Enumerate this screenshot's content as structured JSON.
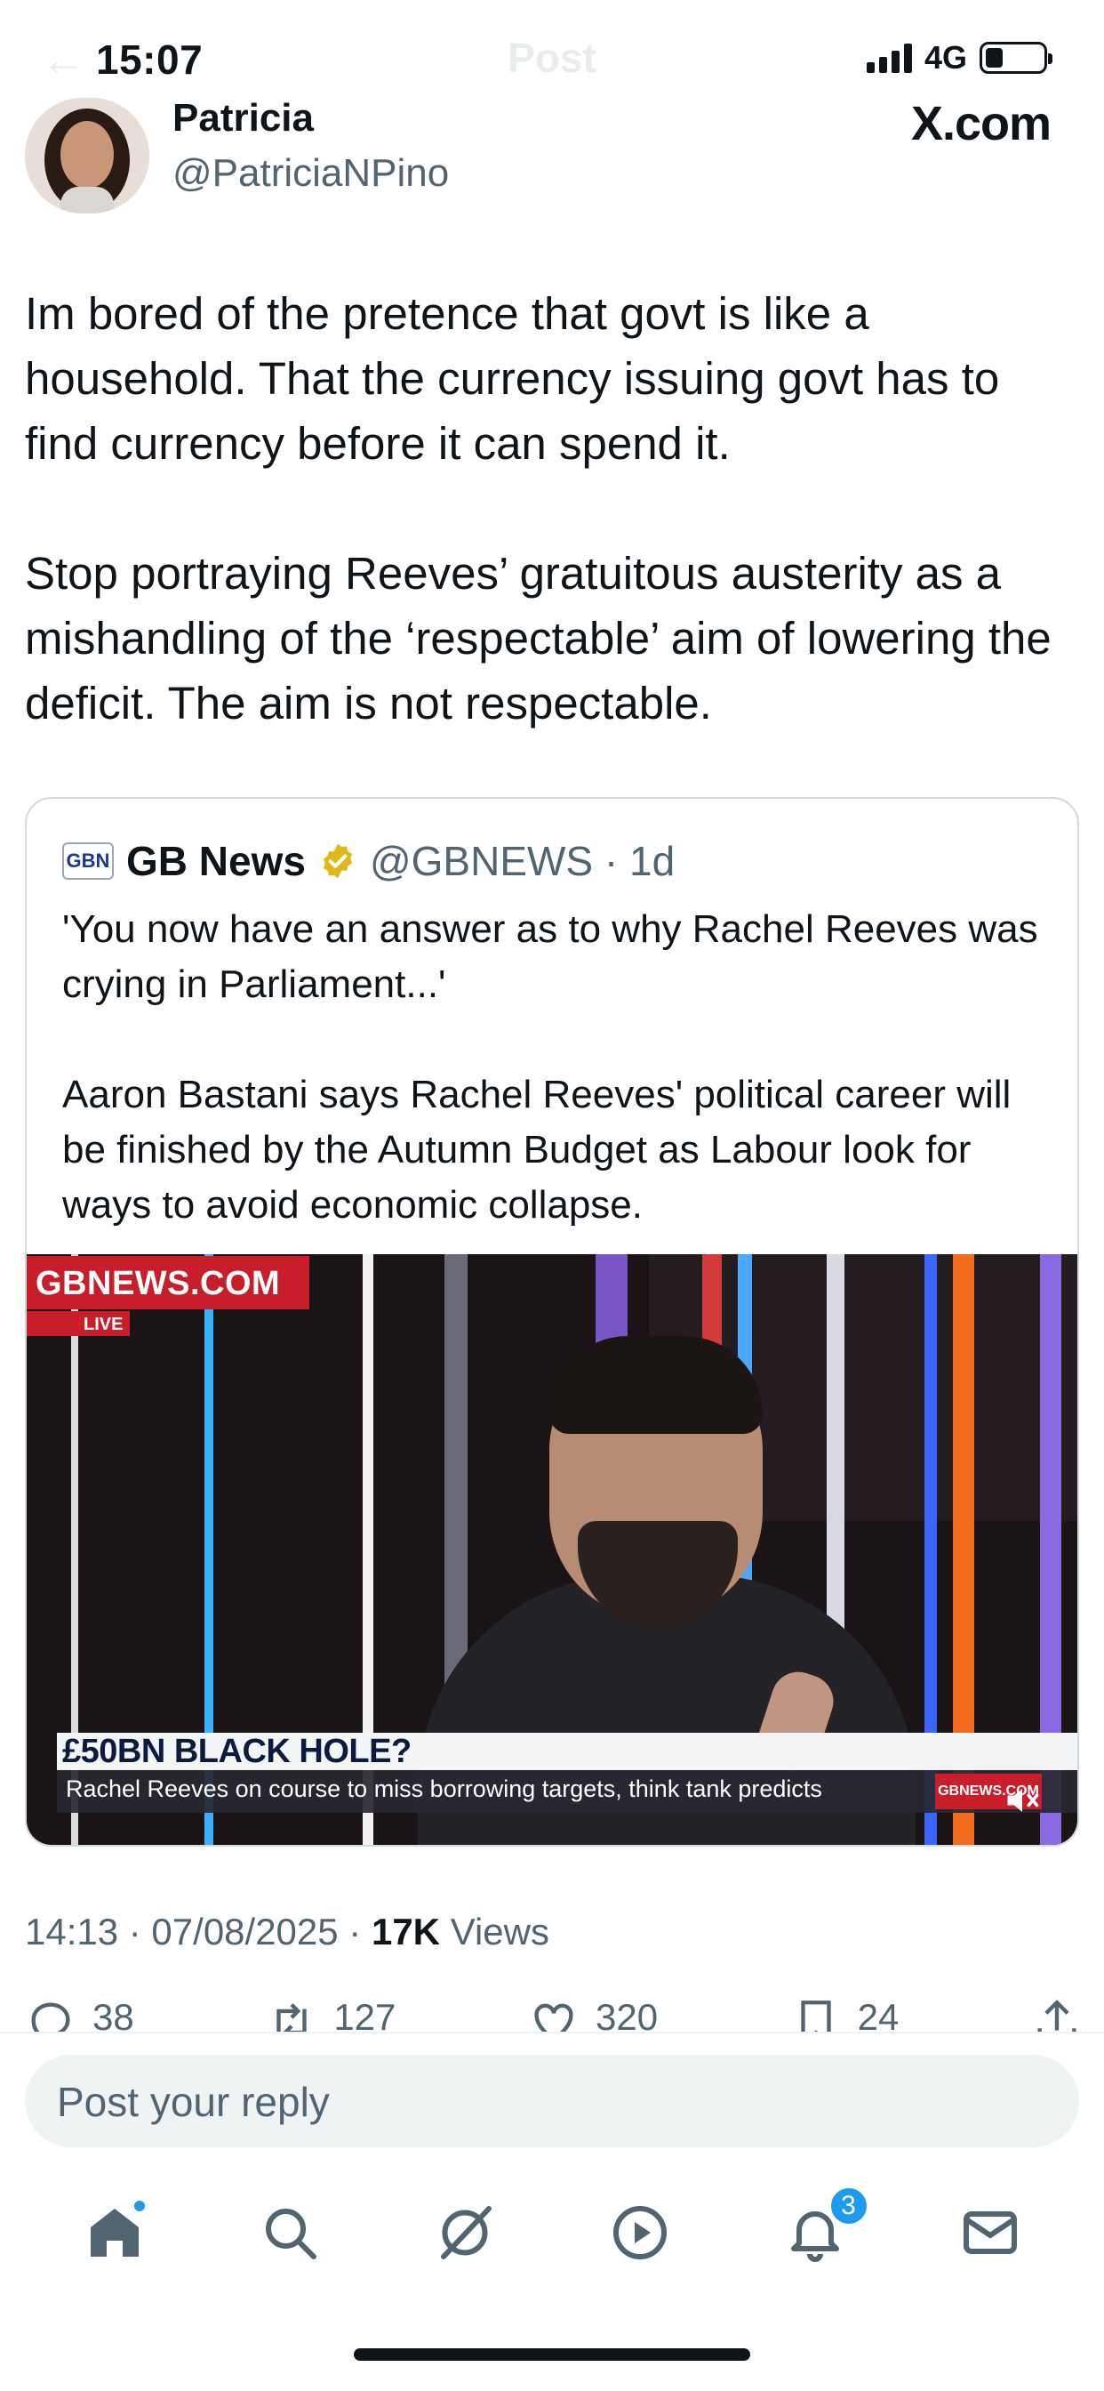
{
  "status_bar": {
    "time": "15:07",
    "network": "4G",
    "battery_level": 0.3
  },
  "header": {
    "title": "Post"
  },
  "author": {
    "name": "Patricia",
    "handle": "@PatriciaNPino",
    "source_badge": "X.com"
  },
  "post": {
    "paragraphs": [
      "Im bored of the pretence that govt is like a household. That the currency issuing govt has to find currency before it can spend it.",
      "Stop portraying Reeves’ gratuitous austerity as a mishandling of the ‘respectable’ aim of lowering the deficit. The aim is not respectable."
    ],
    "timestamp": "14:13 · 07/08/2025 · ",
    "views_count": "17K",
    "views_label": " Views"
  },
  "quote": {
    "logo_text": "GBN",
    "name": "GB News",
    "handle": "@GBNEWS · 1d",
    "paragraphs": [
      "'You now have an answer as to why Rachel Reeves was crying in Parliament...'",
      "Aaron Bastani says Rachel Reeves' political career will be finished by the Autumn Budget as Labour look for ways to avoid economic collapse."
    ],
    "video": {
      "channel_bug": "GBNEWS.COM",
      "live_tag": "LIVE",
      "headline": "£50BN BLACK HOLE?",
      "ticker": "Rachel Reeves on course to miss borrowing targets, think tank predicts",
      "ticker_logo": "GBNEWS.COM"
    }
  },
  "actions": {
    "replies": "38",
    "reposts": "127",
    "likes": "320",
    "bookmarks": "24"
  },
  "reply": {
    "placeholder": "Post your reply"
  },
  "tabbar": {
    "notifications_badge": "3"
  },
  "colors": {
    "accent": "#1d9bf0",
    "secondary_text": "#536471",
    "verified_gold": "#e2b719",
    "brand_red": "#c81e2c"
  }
}
